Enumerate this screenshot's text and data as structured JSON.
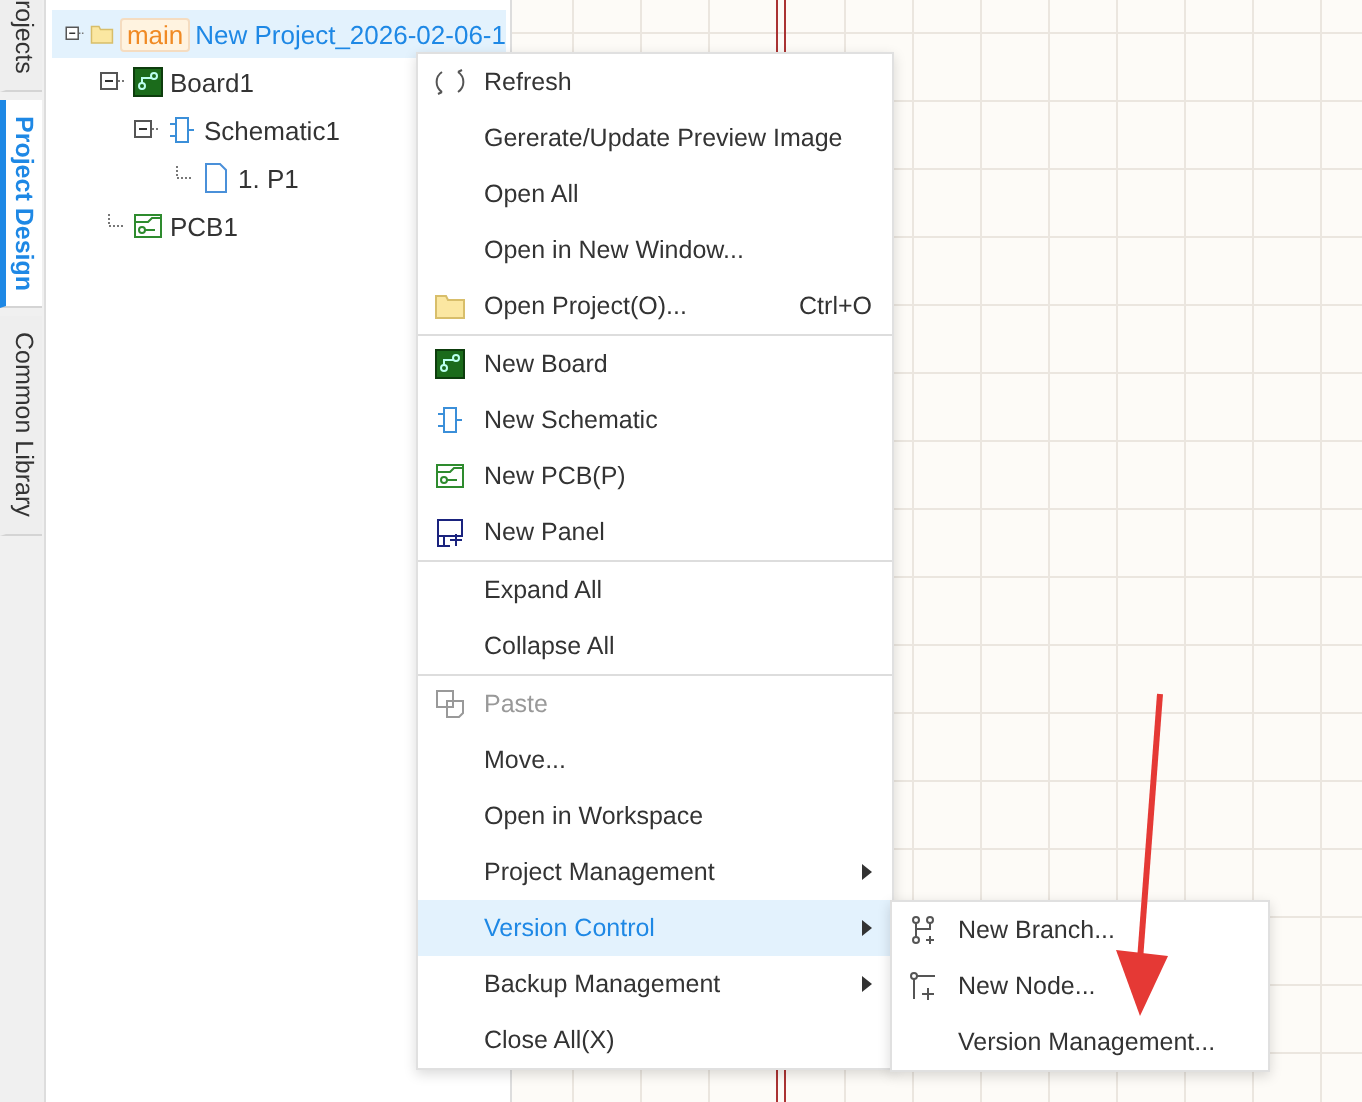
{
  "side_tabs": [
    {
      "label": "rojects",
      "selected": false
    },
    {
      "label": "Project Design",
      "selected": true
    },
    {
      "label": "Common Library",
      "selected": false
    }
  ],
  "tree": [
    {
      "label": "New Project_2026-02-06-1",
      "branch_tag": "main",
      "kind": "folder",
      "expanded": true,
      "selected": true,
      "children": [
        {
          "label": "Board1",
          "kind": "board",
          "expanded": true,
          "selected": false,
          "children": [
            {
              "label": "Schematic1",
              "kind": "schematic",
              "expanded": true,
              "selected": false,
              "children": [
                {
                  "label": "1. P1",
                  "kind": "page",
                  "selected": false
                }
              ]
            }
          ]
        },
        {
          "label": "PCB1",
          "kind": "pcb",
          "selected": false
        }
      ]
    }
  ],
  "context_menu": {
    "groups": [
      [
        {
          "label": "Refresh",
          "kind": "refresh"
        },
        {
          "label": "Gererate/Update Preview Image"
        },
        {
          "label": "Open All"
        },
        {
          "label": "Open in New Window..."
        },
        {
          "label": "Open Project(O)...",
          "kind": "folder",
          "shortcut": "Ctrl+O"
        }
      ],
      [
        {
          "label": "New Board",
          "kind": "board"
        },
        {
          "label": "New Schematic",
          "kind": "schematic"
        },
        {
          "label": "New PCB(P)",
          "kind": "pcb"
        },
        {
          "label": "New Panel",
          "kind": "panel"
        }
      ],
      [
        {
          "label": "Expand All"
        },
        {
          "label": "Collapse All"
        }
      ],
      [
        {
          "label": "Paste",
          "kind": "paste",
          "disabled": true
        },
        {
          "label": "Move..."
        },
        {
          "label": "Open in Workspace"
        },
        {
          "label": "Project Management",
          "submenu": true
        },
        {
          "label": "Version Control",
          "submenu": true,
          "selected": true
        },
        {
          "label": "Backup Management",
          "submenu": true
        },
        {
          "label": "Close All(X)"
        }
      ]
    ]
  },
  "submenu": [
    {
      "label": "New Branch...",
      "kind": "branch"
    },
    {
      "label": "New Node...",
      "kind": "node"
    },
    {
      "label": "Version Management..."
    }
  ]
}
